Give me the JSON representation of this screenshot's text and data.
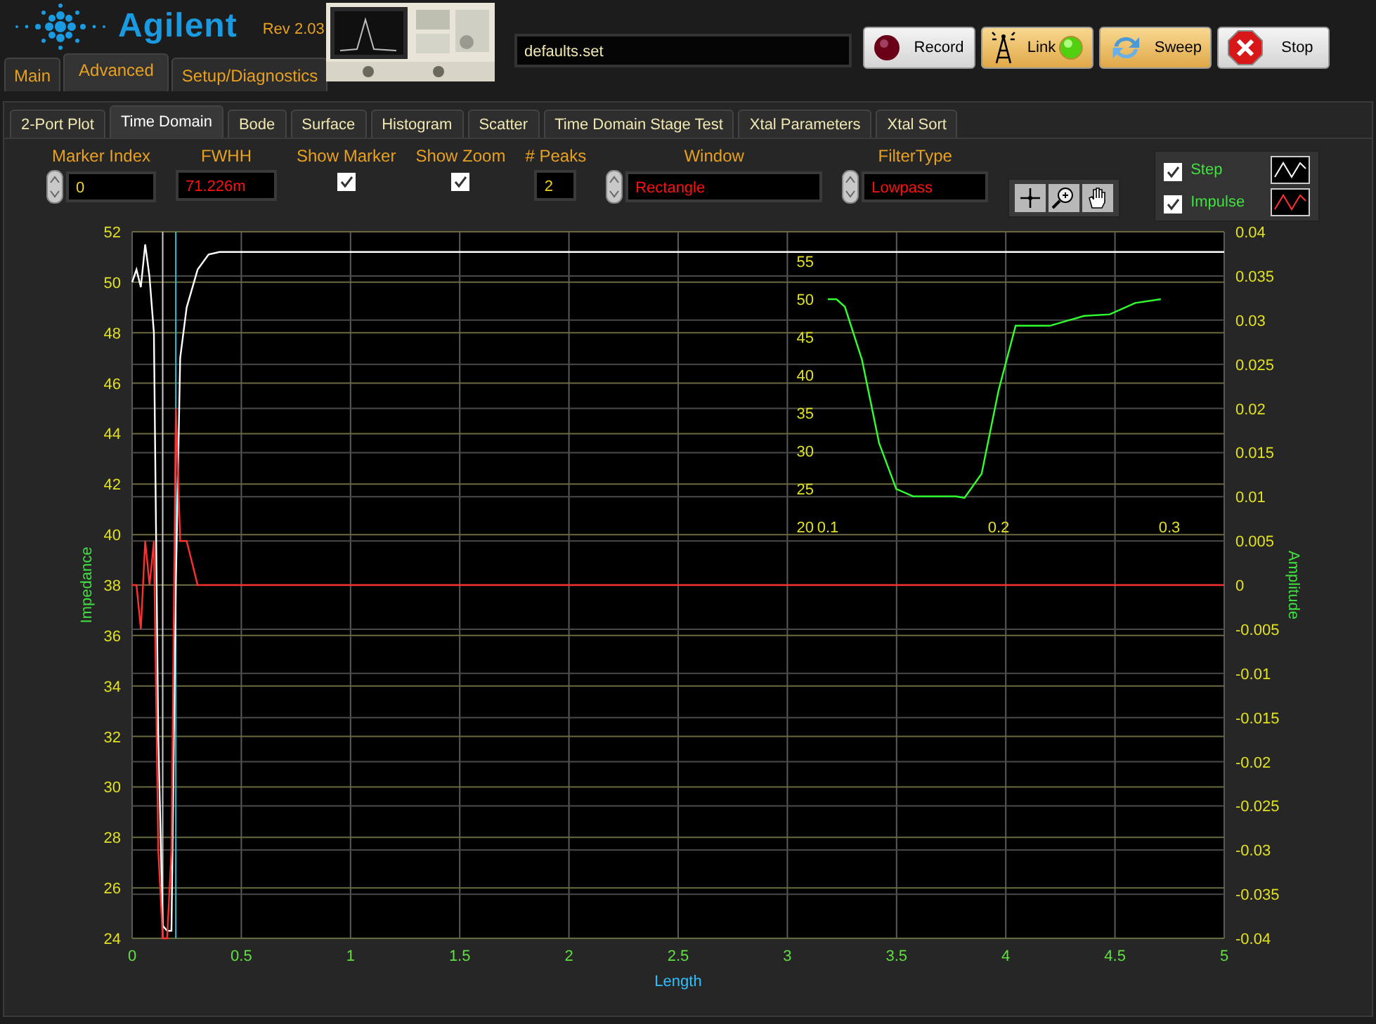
{
  "app": {
    "name": "Agilent",
    "version": "Rev 2.03"
  },
  "main_tabs": [
    {
      "label": "Main",
      "selected": false
    },
    {
      "label": "Advanced",
      "selected": true
    },
    {
      "label": "Setup/Diagnostics",
      "selected": false
    }
  ],
  "file_field": {
    "value": "defaults.set"
  },
  "buttons": [
    {
      "kind": "record",
      "label": "Record",
      "active": false
    },
    {
      "kind": "link",
      "label": "Link",
      "active": true
    },
    {
      "kind": "sweep",
      "label": "Sweep",
      "active": true
    },
    {
      "kind": "stop",
      "label": "Stop",
      "active": false
    }
  ],
  "sub_tabs": [
    {
      "label": "2-Port Plot",
      "selected": false
    },
    {
      "label": "Time Domain",
      "selected": true
    },
    {
      "label": "Bode",
      "selected": false
    },
    {
      "label": "Surface",
      "selected": false
    },
    {
      "label": "Histogram",
      "selected": false
    },
    {
      "label": "Scatter",
      "selected": false
    },
    {
      "label": "Time Domain Stage Test",
      "selected": false
    },
    {
      "label": "Xtal Parameters",
      "selected": false
    },
    {
      "label": "Xtal Sort",
      "selected": false
    }
  ],
  "controls": [
    {
      "kind": "spinner",
      "label": "Marker Index",
      "value": "0",
      "highlight": false
    },
    {
      "kind": "readout",
      "label": "FWHH",
      "value": "71.226m",
      "highlight": true
    },
    {
      "kind": "checkbox",
      "label": "Show Marker",
      "checked": true
    },
    {
      "kind": "checkbox",
      "label": "Show Zoom",
      "checked": true
    },
    {
      "kind": "readout",
      "label": "# Peaks",
      "value": "2",
      "highlight": false
    },
    {
      "kind": "spinner",
      "label": "Window",
      "value": "Rectangle",
      "highlight": true
    },
    {
      "kind": "spinner",
      "label": "FilterType",
      "value": "Lowpass",
      "highlight": true
    }
  ],
  "legend": [
    {
      "checked": true
    },
    {
      "checked": true
    }
  ],
  "chart": {
    "chart_data": {
      "type": "line",
      "xlabel": "Length",
      "ylabel": "Impedance",
      "x": [
        0,
        0.02,
        0.04,
        0.06,
        0.08,
        0.1,
        0.12,
        0.14,
        0.16,
        0.18,
        0.2,
        0.22,
        0.25,
        0.3,
        0.35,
        0.4,
        0.5,
        1,
        2,
        3,
        4,
        5
      ],
      "series": [
        {
          "name": "Step",
          "color": "#ffffff",
          "values": [
            50,
            50.5,
            49.8,
            51.5,
            50.2,
            48,
            32,
            24.5,
            24.3,
            24.3,
            38,
            47,
            49,
            50.5,
            51.1,
            51.2,
            51.2,
            51.2,
            51.2,
            51.2,
            51.2,
            51.2
          ]
        },
        {
          "name": "Impulse",
          "color": "#ff3030",
          "axis": "y2",
          "values": [
            0,
            0,
            -0.005,
            0.005,
            0,
            0.005,
            -0.03,
            -0.04,
            -0.04,
            -0.03,
            0.02,
            0.005,
            0.005,
            0,
            0,
            0,
            0,
            0,
            0,
            0,
            0,
            0
          ]
        }
      ],
      "xlim": [
        0,
        5
      ],
      "ylim": [
        24,
        52
      ],
      "xticks": [
        0,
        0.5,
        1,
        1.5,
        2,
        2.5,
        3,
        3.5,
        4,
        4.5,
        5
      ],
      "yticks": [
        24,
        26,
        28,
        30,
        32,
        34,
        36,
        38,
        40,
        42,
        44,
        46,
        48,
        50,
        52
      ],
      "y2label": "Amplitude",
      "y2lim": [
        -0.04,
        0.04
      ],
      "grid": true,
      "ref_lines": [
        {
          "axis": "x",
          "value": 0.14,
          "color": "#cccccc"
        },
        {
          "axis": "x",
          "value": 0.2,
          "color": "#30c0d0"
        }
      ],
      "y2ticks": [
        -0.04,
        -0.035,
        -0.03,
        -0.025,
        -0.02,
        -0.015,
        -0.01,
        -0.005,
        0,
        0.005,
        0.01,
        0.015,
        0.02,
        0.025,
        0.03,
        0.035,
        0.04
      ]
    },
    "zoom_chart": {
      "chart_data": {
        "type": "line",
        "x": [
          0.1,
          0.105,
          0.11,
          0.12,
          0.13,
          0.14,
          0.15,
          0.16,
          0.175,
          0.18,
          0.19,
          0.2,
          0.21,
          0.23,
          0.25,
          0.265,
          0.28,
          0.295
        ],
        "series": [
          {
            "color": "#30ff30",
            "values": [
              50,
              50,
              49,
              42,
              31,
              25,
              24,
              24,
              24,
              23.8,
              27,
              38,
              46.5,
              46.5,
              47.8,
              48,
              49.5,
              50
            ]
          }
        ],
        "xlim": [
          0.1,
          0.3
        ],
        "ylim": [
          20,
          55
        ],
        "xticks": [
          0.1,
          0.2,
          0.3
        ],
        "yticks": [
          20,
          25,
          30,
          35,
          40,
          45,
          50,
          55
        ]
      }
    }
  }
}
